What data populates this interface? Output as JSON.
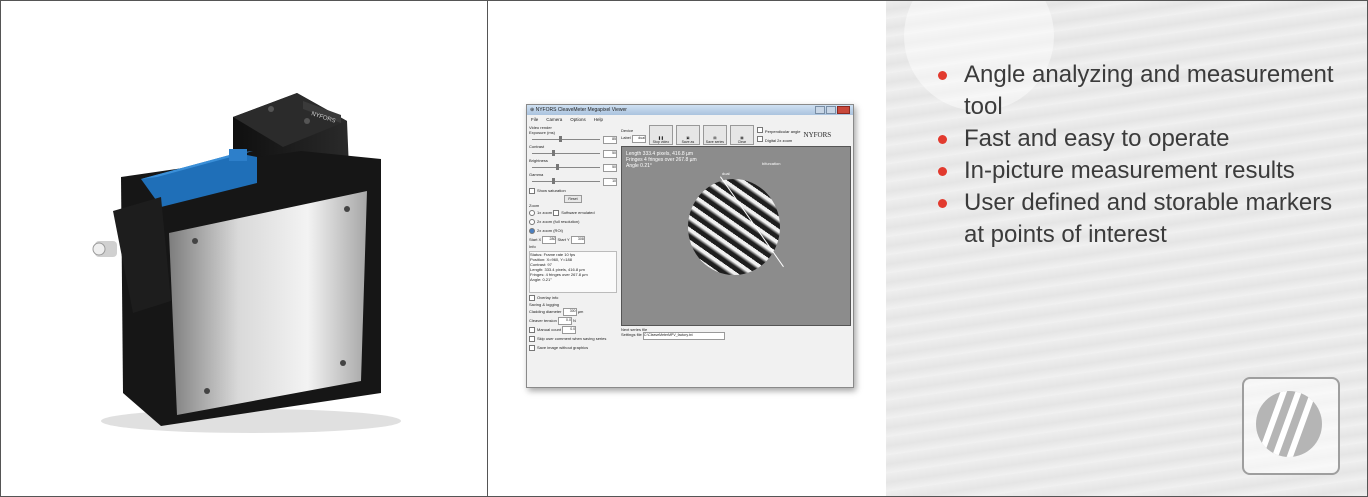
{
  "colors": {
    "bullet": "#e23a2e",
    "text": "#3b3b3b",
    "brand_blue": "#1f6fb8"
  },
  "device": {
    "brand_label": "NYFORS"
  },
  "app": {
    "title": "NYFORS CleaveMeter Megapixel Viewer",
    "menu": [
      "File",
      "Camera",
      "Options",
      "Help"
    ],
    "video_render": "Video render",
    "exposure_label": "Exposure (ms)",
    "exposure_value": "85",
    "contrast_label": "Contrast",
    "contrast_value": "50",
    "brightness_label": "Brightness",
    "brightness_value": "50",
    "gamma_label": "Gamma",
    "gamma_value": "10",
    "show_saturation": "Show saturation",
    "reset": "Reset",
    "zoom_title": "Zoom",
    "zoom_1x": "1x zoom",
    "software_emulated": "Software emulated",
    "zoom_2x_full": "2x zoom (full resolution)",
    "zoom_2x_roi": "2x zoom (ROI)",
    "start_x_label": "Start X",
    "start_x_value": "280",
    "start_y_label": "Start Y",
    "start_y_value": "308",
    "info_title": "Info",
    "info_rows": [
      {
        "k": "Status",
        "v": "Frame rate 10 fps"
      },
      {
        "k": "Position",
        "v": "X=960, Y=188"
      },
      {
        "k": "Contrast",
        "v": "97"
      },
      {
        "k": "Length",
        "v": "333.4 pixels, 416.8 µm"
      },
      {
        "k": "Fringes",
        "v": "4 fringes over 267.8 µm"
      },
      {
        "k": "Angle",
        "v": "0.21°"
      }
    ],
    "overlay_info": "Overlay info",
    "saving_title": "Saving & logging",
    "cladding_label": "Cladding diameter",
    "cladding_value": "300",
    "cladding_unit": "µm",
    "cleaver_label": "Cleaver tension",
    "cleaver_value": "0.0",
    "cleaver_unit": "N",
    "manual_count": "Manual count",
    "manual_value": "0.0",
    "skip_comment": "Skip user comment when saving series",
    "save_without_graphics": "Save image without graphics",
    "device_label": "Device",
    "label_label": "Label",
    "label_value": "dual",
    "toolbar": [
      "Stop video",
      "Save as",
      "Save series",
      "Clear"
    ],
    "perpendicular": "Perpendicular angle",
    "digital_zoom": "Digital 2x zoom",
    "logo": "NYFORS",
    "overlay_lines": [
      "Length 333.4 pixels, 416.8 µm",
      "Fringes 4 fringes over 267.8 µm",
      "Angle 0.21°"
    ],
    "marker_dual": "dual",
    "marker_ref": "bifurcation",
    "next_series_label": "Next series file",
    "settings_label": "Settings file",
    "settings_value": "C:\\CleaveMeterMPV_factory.txt"
  },
  "features": [
    "Angle analyzing and measurement tool",
    "Fast and easy to operate",
    "In-picture measurement results",
    "User defined and storable markers at points of interest"
  ]
}
